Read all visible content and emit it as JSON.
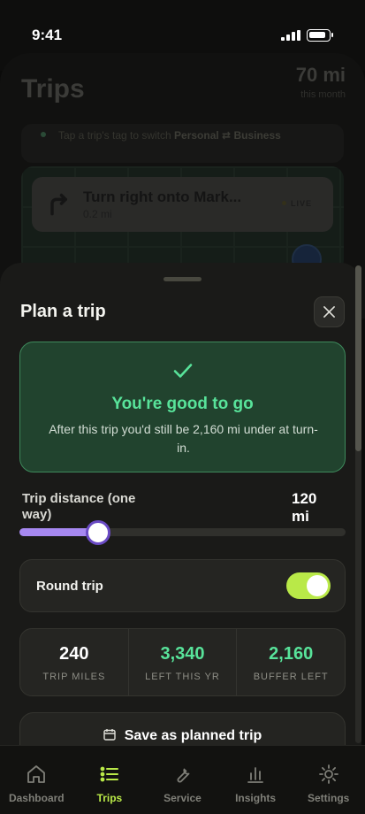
{
  "status_bar": {
    "time": "9:41"
  },
  "background": {
    "title": "Trips",
    "miles": "70 mi",
    "miles_sub": "this month",
    "hint_text": "Tap a trip's tag to switch",
    "hint_bold": "Personal ⇄ Business",
    "nav_title": "Turn right onto Mark...",
    "nav_sub": "0.2 mi",
    "nav_live": "LIVE"
  },
  "sheet": {
    "title": "Plan a trip",
    "status_card": {
      "title": "You're good to go",
      "text": "After this trip you'd still be 2,160 mi under at turn-in."
    },
    "slider": {
      "label": "Trip distance (one way)",
      "value_text": "120 mi",
      "fraction": 0.24
    },
    "round_trip": {
      "label": "Round trip",
      "on": true
    },
    "stats": [
      {
        "value": "240",
        "label": "TRIP MILES",
        "color": "#ffffff"
      },
      {
        "value": "3,340",
        "label": "LEFT THIS YR",
        "color": "#58e39a"
      },
      {
        "value": "2,160",
        "label": "BUFFER LEFT",
        "color": "#58e39a"
      }
    ],
    "save_label": "Save as planned trip"
  },
  "tabs": [
    {
      "label": "Dashboard",
      "icon": "home-icon",
      "active": false
    },
    {
      "label": "Trips",
      "icon": "list-icon",
      "active": true
    },
    {
      "label": "Service",
      "icon": "wrench-icon",
      "active": false
    },
    {
      "label": "Insights",
      "icon": "bar-chart-icon",
      "active": false
    },
    {
      "label": "Settings",
      "icon": "sun-gear-icon",
      "active": false
    }
  ],
  "colors": {
    "accent": "#b9e948",
    "success": "#58e39a",
    "slider": "#a688f0"
  }
}
